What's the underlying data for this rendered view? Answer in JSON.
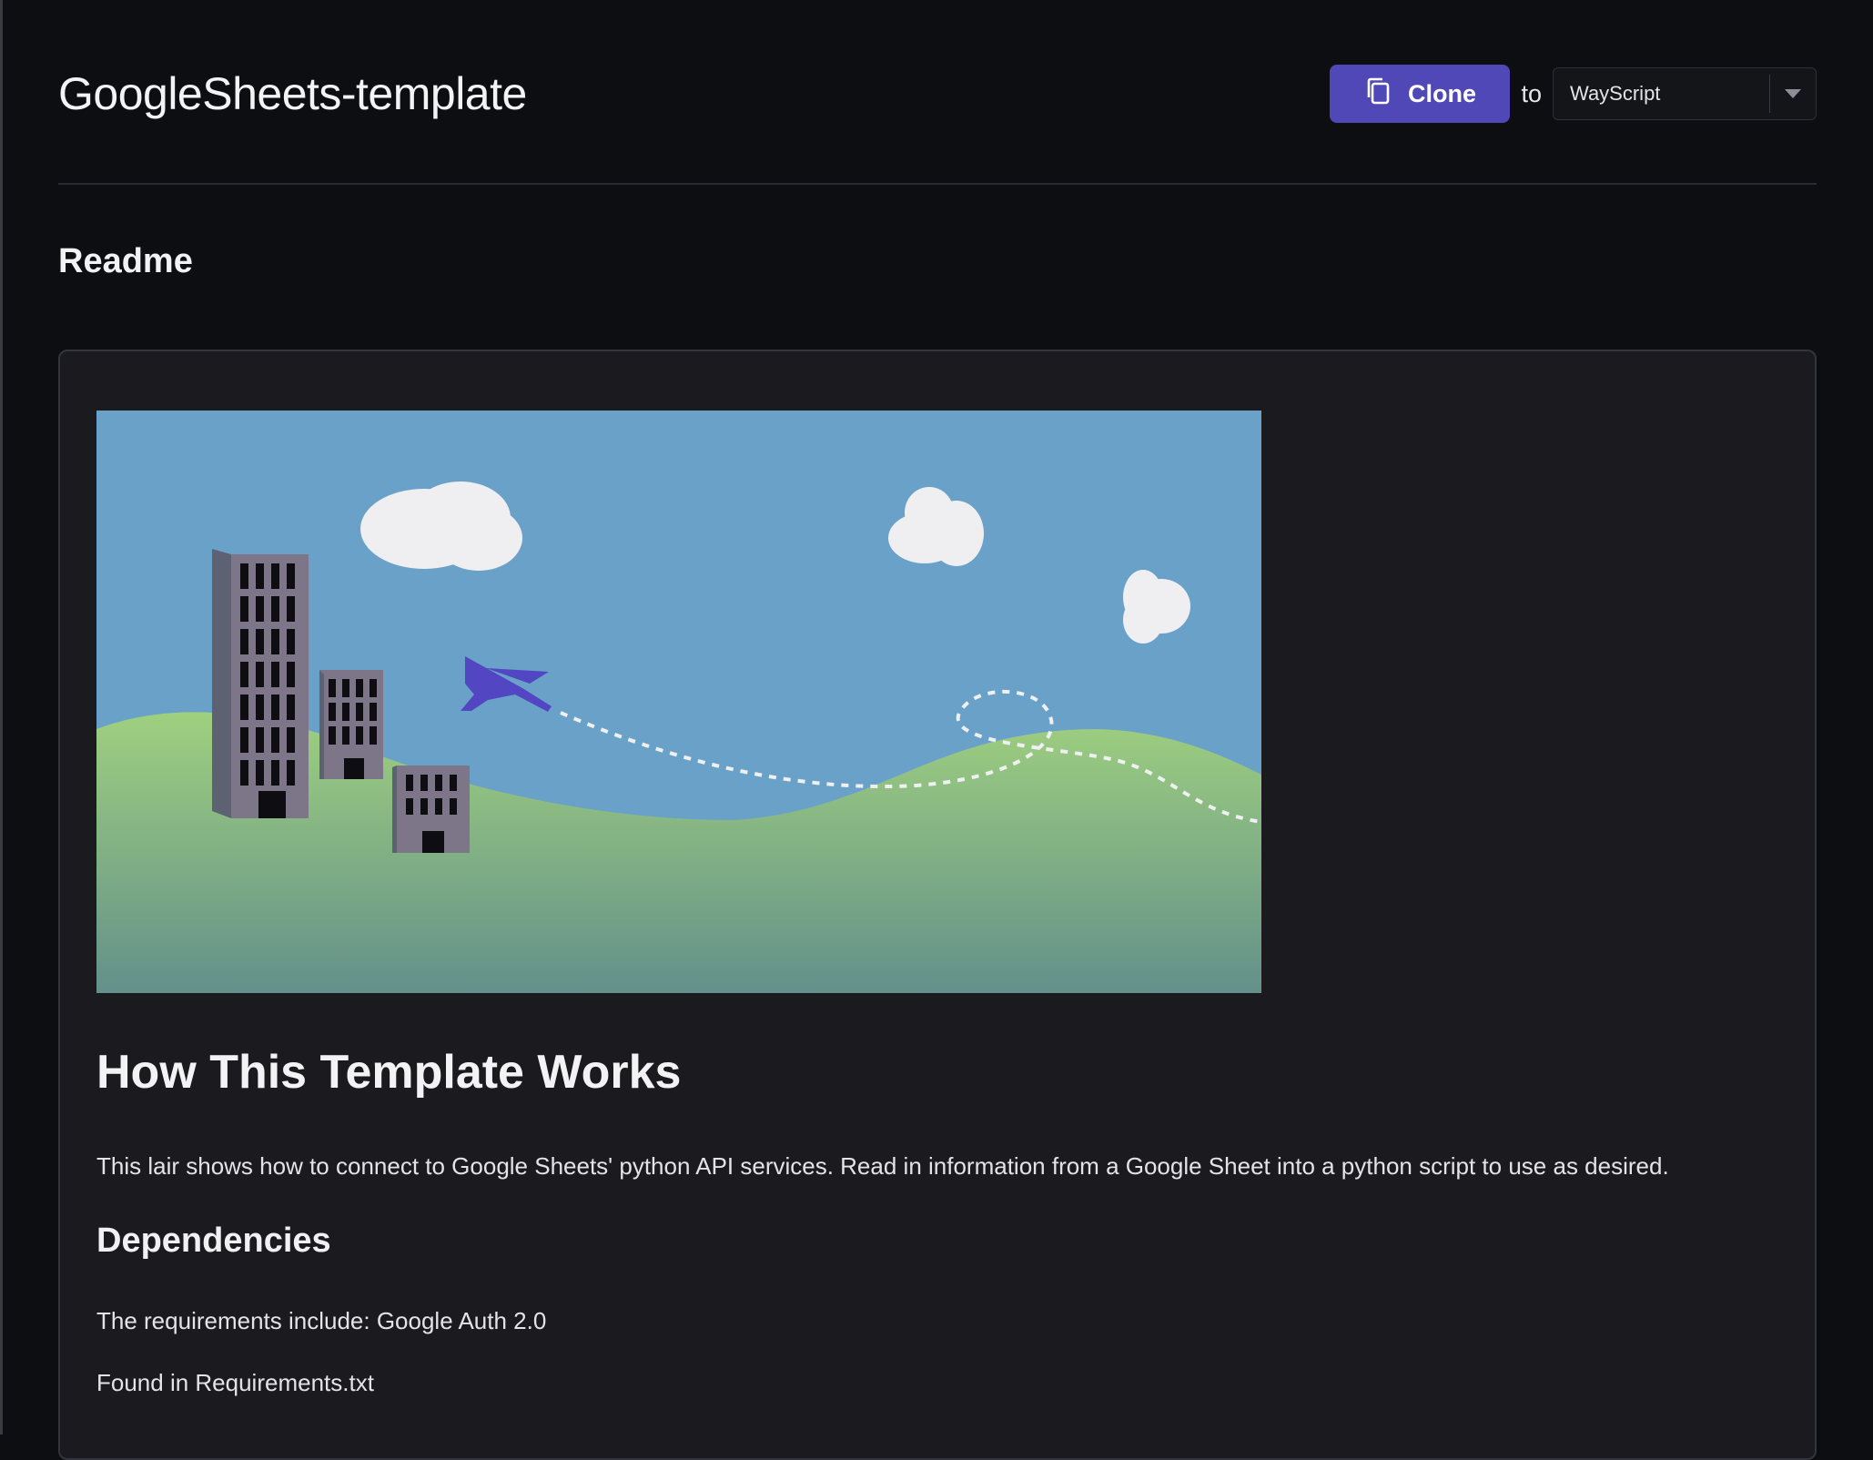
{
  "page": {
    "title": "GoogleSheets-template"
  },
  "toolbar": {
    "clone_label": "Clone",
    "to_label": "to",
    "destination_selected": "WayScript",
    "clone_icon": "copy-icon",
    "dropdown_icon": "caret-down-icon"
  },
  "readme": {
    "section_title": "Readme",
    "heading": "How This Template Works",
    "intro": "This lair shows how to connect to Google Sheets' python API services. Read in information from a Google Sheet into a python script to use as desired.",
    "dependencies_heading": "Dependencies",
    "requirements_text": "The requirements include: Google Auth 2.0",
    "found_in_text": "Found in Requirements.txt"
  },
  "colors": {
    "background": "#0d0e11",
    "panel": "#1a1a1f",
    "accent": "#5148b8",
    "sky": "#6aa1c8",
    "hill_top": "#9ccf7f",
    "hill_bottom": "#679289"
  }
}
